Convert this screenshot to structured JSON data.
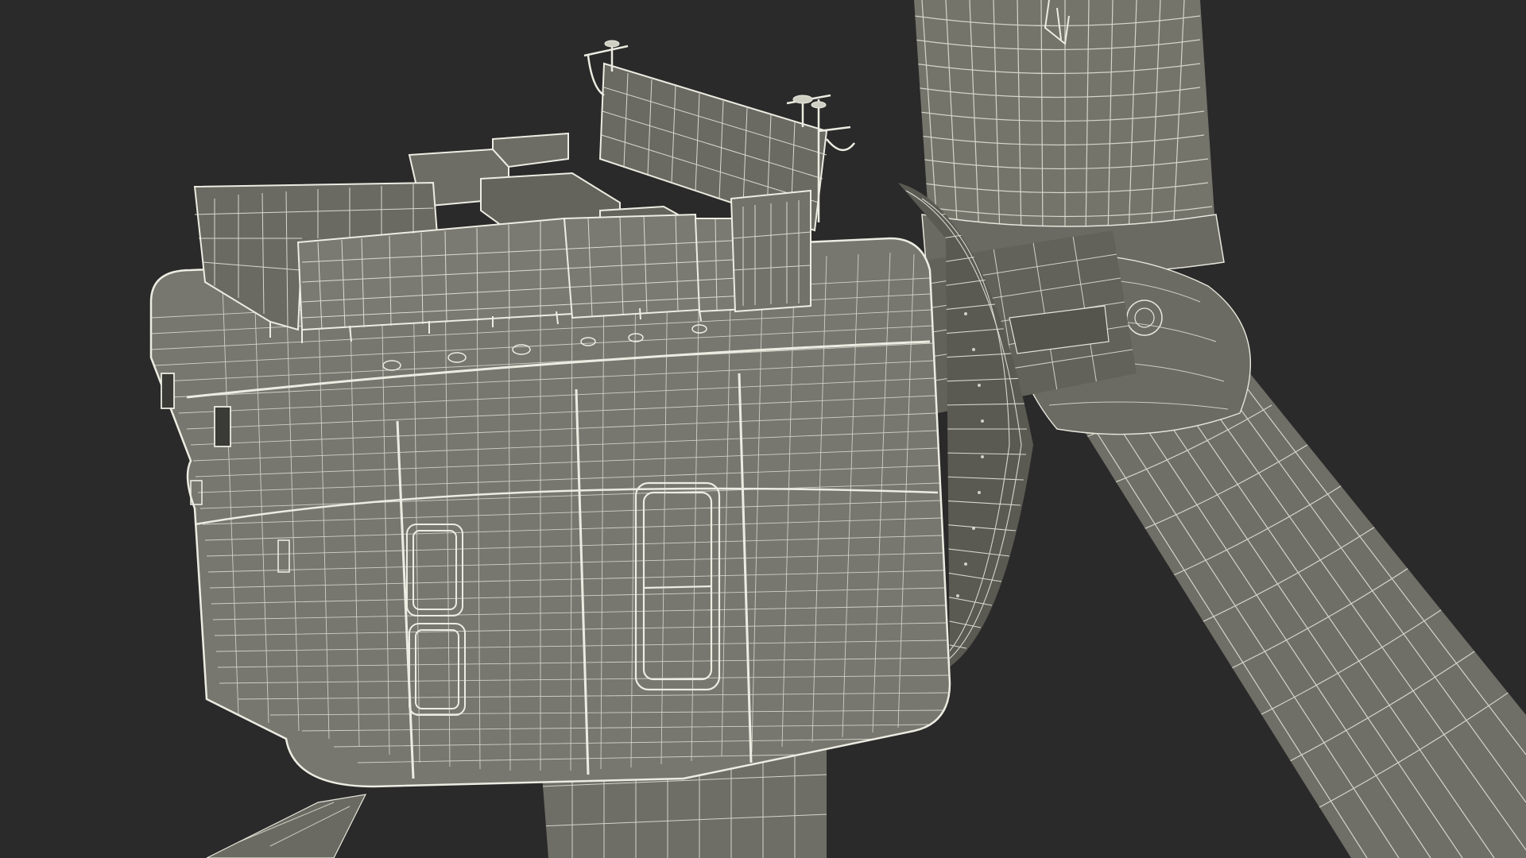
{
  "scene": {
    "subject": "wind-turbine-nacelle-wireframe",
    "background_color": "#2a2a2a",
    "surface_color": "#74746b",
    "surface_dark_color": "#5d5d55",
    "wire_color": "#e6e6dc",
    "wire_dim_color": "#c9c9bd"
  }
}
